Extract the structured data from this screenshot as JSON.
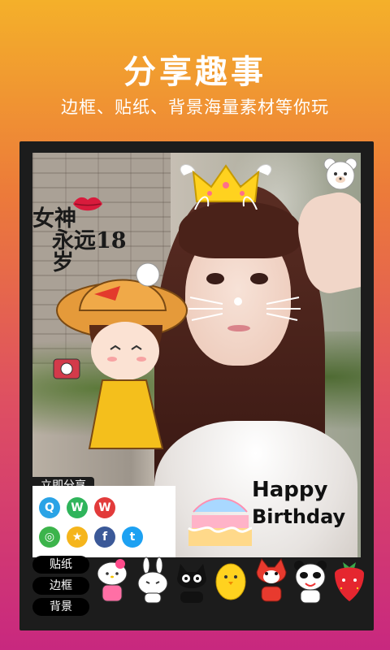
{
  "headline": "分享趣事",
  "subheadline": "边框、贴纸、背景海量素材等你玩",
  "photo": {
    "text_sticker": {
      "line1": "女神",
      "line2": "永远18岁"
    },
    "birthday_sticker": {
      "line1": "Happy",
      "line2": "Birthday"
    }
  },
  "share": {
    "label": "立即分享",
    "icons": [
      {
        "name": "qq-icon",
        "glyph": "Q",
        "color": "#2aa3e6"
      },
      {
        "name": "wechat-icon",
        "glyph": "W",
        "color": "#2fb45b"
      },
      {
        "name": "weibo-icon",
        "glyph": "W",
        "color": "#e23b3b"
      },
      {
        "name": "moments-icon",
        "glyph": "◎",
        "color": "#3cb44b"
      },
      {
        "name": "qzone-icon",
        "glyph": "★",
        "color": "#f5b51c"
      },
      {
        "name": "facebook-icon",
        "glyph": "f",
        "color": "#3b5998"
      },
      {
        "name": "twitter-icon",
        "glyph": "t",
        "color": "#1da1f2"
      }
    ]
  },
  "tabs": [
    {
      "label": "贴纸"
    },
    {
      "label": "边框"
    },
    {
      "label": "背景"
    }
  ],
  "stickers": [
    {
      "name": "hello-kitty-sticker-icon"
    },
    {
      "name": "white-rabbit-sticker-icon"
    },
    {
      "name": "black-cat-sticker-icon"
    },
    {
      "name": "yellow-chick-sticker-icon"
    },
    {
      "name": "red-fox-sticker-icon"
    },
    {
      "name": "panda-sticker-icon"
    },
    {
      "name": "strawberry-sticker-icon"
    }
  ]
}
